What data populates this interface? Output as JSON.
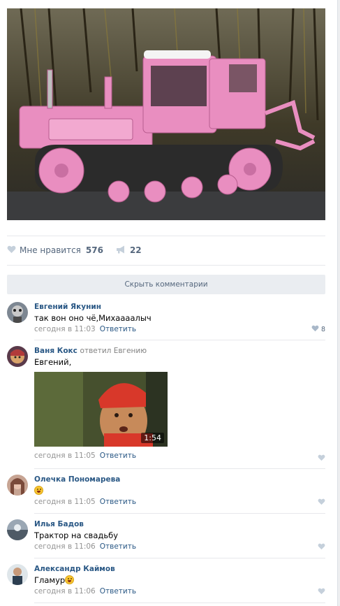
{
  "post": {
    "photo_description": "pink-tractor-photo",
    "likes_label": "Мне нравится",
    "likes_count": "576",
    "shares_count": "22"
  },
  "hide_comments_label": "Скрыть комментарии",
  "comments": [
    {
      "author": "Евгений Якунин",
      "reply_to": "",
      "text": "так вон оно чё,Михаааалыч",
      "time": "сегодня в 11:03",
      "reply_label": "Ответить",
      "likes": "8"
    },
    {
      "author": "Ваня Кокс",
      "reply_to": "ответил Евгению",
      "text": "Евгений,",
      "time": "сегодня в 11:05",
      "reply_label": "Ответить",
      "likes": "",
      "video_duration": "1:54"
    },
    {
      "author": "Олечка Пономарева",
      "reply_to": "",
      "text": "",
      "time": "сегодня в 11:05",
      "reply_label": "Ответить",
      "likes": ""
    },
    {
      "author": "Илья Бадов",
      "reply_to": "",
      "text": "Трактор на свадьбу",
      "time": "сегодня в 11:06",
      "reply_label": "Ответить",
      "likes": ""
    },
    {
      "author": "Александр Каймов",
      "reply_to": "",
      "text": "Гламур",
      "time": "сегодня в 11:06",
      "reply_label": "Ответить",
      "likes": ""
    }
  ],
  "colors": {
    "link": "#2a5885",
    "meta": "#939393",
    "like_icon": "#a0b0c4",
    "tractor": "#e98ec0"
  }
}
